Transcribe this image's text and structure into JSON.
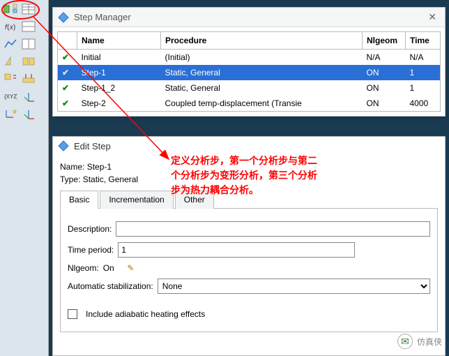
{
  "step_manager": {
    "title": "Step Manager",
    "headers": {
      "name": "Name",
      "procedure": "Procedure",
      "nlgeom": "Nlgeom",
      "time": "Time"
    },
    "rows": [
      {
        "name": "Initial",
        "procedure": "(Initial)",
        "nlgeom": "N/A",
        "time": "N/A"
      },
      {
        "name": "Step-1",
        "procedure": "Static, General",
        "nlgeom": "ON",
        "time": "1"
      },
      {
        "name": "Step-1_2",
        "procedure": "Static, General",
        "nlgeom": "ON",
        "time": "1"
      },
      {
        "name": "Step-2",
        "procedure": "Coupled temp-displacement (Transie",
        "nlgeom": "ON",
        "time": "4000"
      }
    ]
  },
  "edit_step": {
    "title": "Edit Step",
    "name_label": "Name:",
    "name_value": "Step-1",
    "type_label": "Type:",
    "type_value": "Static, General",
    "tabs": {
      "basic": "Basic",
      "incrementation": "Incrementation",
      "other": "Other"
    },
    "description_label": "Description:",
    "description_value": "",
    "time_period_label": "Time period:",
    "time_period_value": "1",
    "nlgeom_label": "Nlgeom:",
    "nlgeom_value": "On",
    "auto_stab_label": "Automatic stabilization:",
    "auto_stab_value": "None",
    "adiabatic_label": "Include adiabatic heating effects"
  },
  "annotation": {
    "line1": "定义分析步，第一个分析步与第二",
    "line2": "个分析步为变形分析，第三个分析",
    "line3": "步为热力耦合分析。"
  },
  "watermark": {
    "text": "仿真侠"
  }
}
